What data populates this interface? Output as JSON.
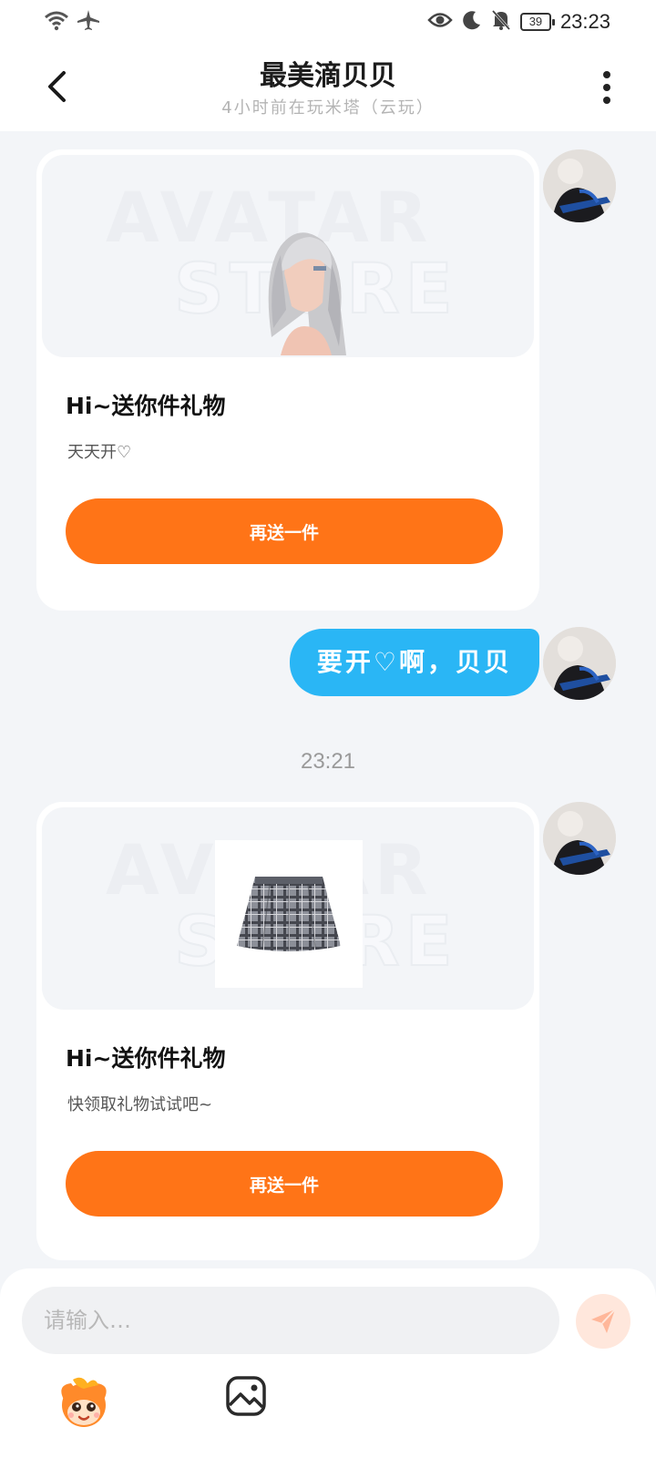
{
  "status_bar": {
    "battery": "39",
    "time": "23:23"
  },
  "header": {
    "title": "最美滴贝贝",
    "subtitle": "4小时前在玩米塔（云玩）"
  },
  "messages": [
    {
      "type": "gift",
      "watermark_line1": "AVATAR",
      "watermark_line2": "STORE",
      "title": "Hi~送你件礼物",
      "description": "天天开♡",
      "button_label": "再送一件"
    },
    {
      "type": "text",
      "text": "要开♡啊，贝贝"
    },
    {
      "type": "time",
      "text": "23:21"
    },
    {
      "type": "gift",
      "watermark_line1": "AVATAR",
      "watermark_line2": "STORE",
      "title": "Hi~送你件礼物",
      "description": "快领取礼物试试吧~",
      "button_label": "再送一件"
    }
  ],
  "input": {
    "placeholder": "请输入…",
    "value": ""
  },
  "toolbar": {
    "icons": [
      "mascot-icon",
      "image-icon"
    ]
  },
  "colors": {
    "accent_orange": "#ff7417",
    "bubble_blue": "#2ab6f5",
    "background": "#f3f5f8"
  }
}
